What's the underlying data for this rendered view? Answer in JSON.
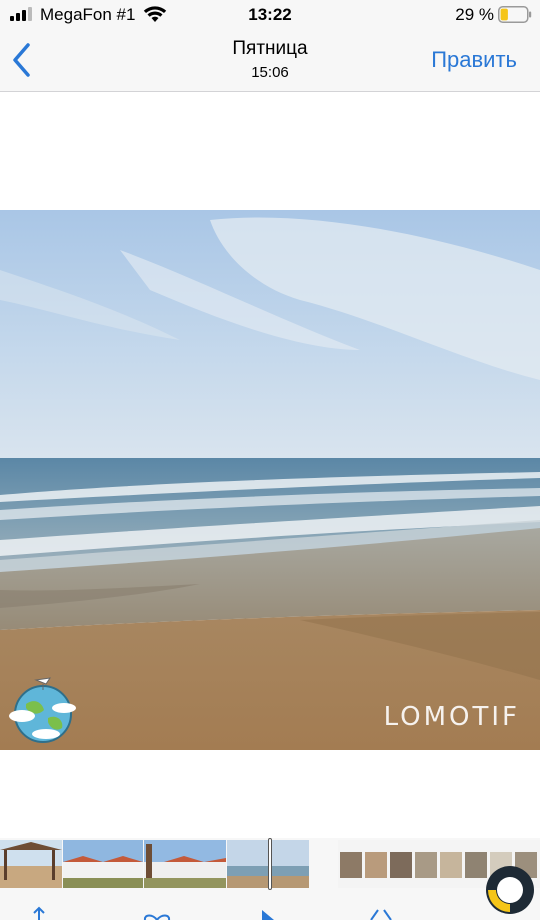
{
  "status_bar": {
    "carrier": "MegaFon #1",
    "time": "13:22",
    "battery_percent": "29 %",
    "battery_level": 0.29
  },
  "nav": {
    "back_icon": "chevron-left-icon",
    "title": "Пятница",
    "subtitle": "15:06",
    "edit_label": "Править"
  },
  "photo": {
    "watermark": "LOMOTIF",
    "sticker": "globe-sticker"
  },
  "toolbar": {
    "icons": [
      "share-icon",
      "heart-icon",
      "play-icon",
      "delete-icon"
    ]
  },
  "colors": {
    "accent": "#2a78d6",
    "battery_fill": "#f5c518",
    "bar_background": "#f7f7f7"
  }
}
